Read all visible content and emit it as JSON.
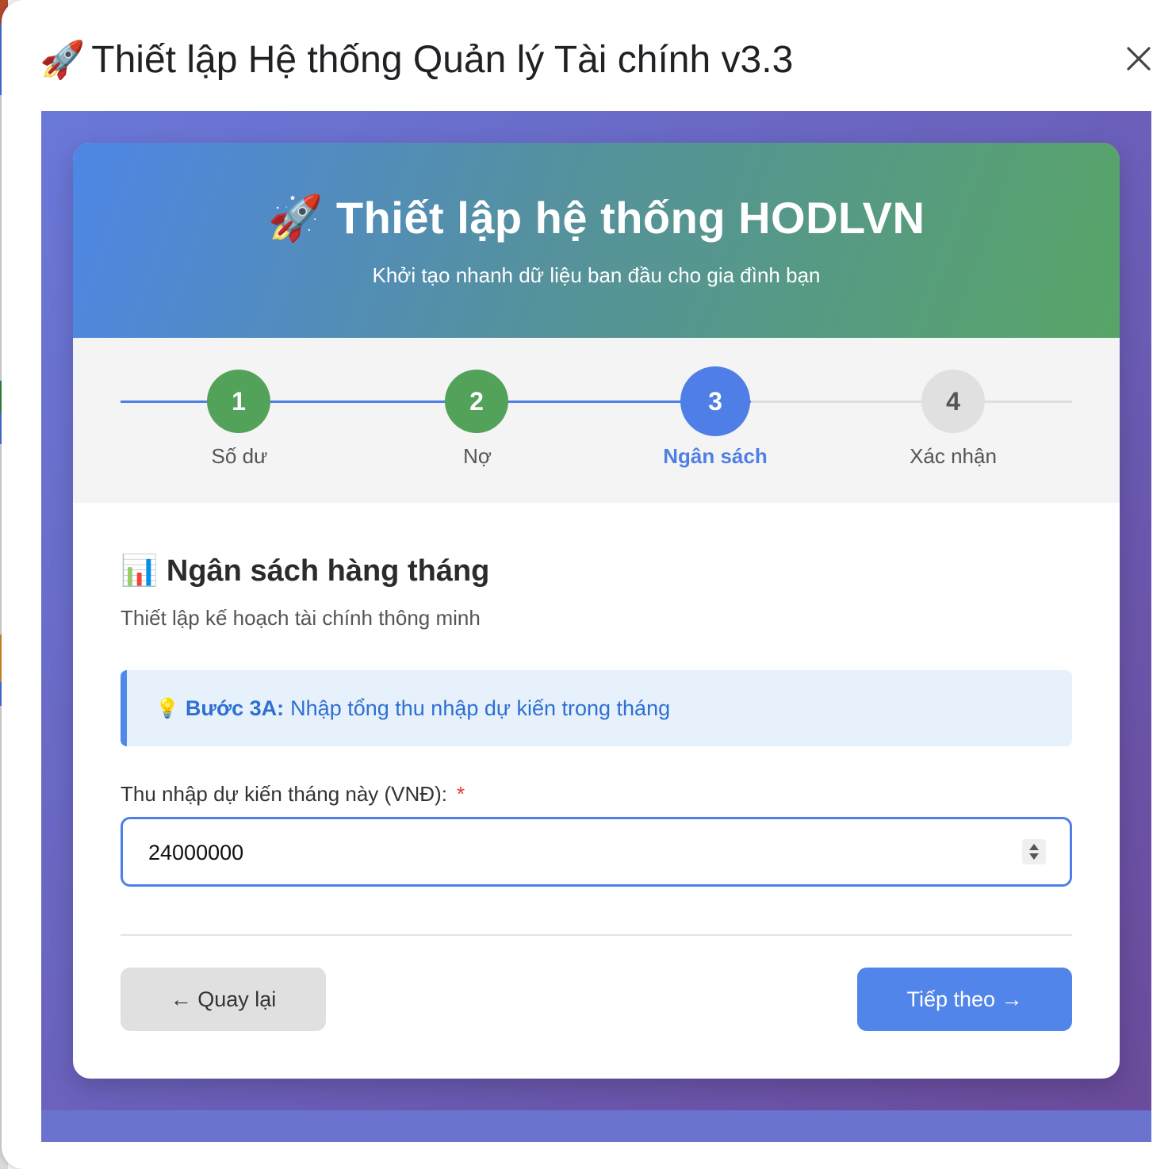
{
  "dialog": {
    "title_icon": "🚀",
    "title": "Thiết lập Hệ thống Quản lý Tài chính v3.3",
    "close_icon": "close-icon"
  },
  "hero": {
    "icon": "🚀",
    "title": "Thiết lập hệ thống HODLVN",
    "subtitle": "Khởi tạo nhanh dữ liệu ban đầu cho gia đình bạn"
  },
  "steps": [
    {
      "number": "1",
      "label": "Số dư",
      "state": "done"
    },
    {
      "number": "2",
      "label": "Nợ",
      "state": "done"
    },
    {
      "number": "3",
      "label": "Ngân sách",
      "state": "active"
    },
    {
      "number": "4",
      "label": "Xác nhận",
      "state": "todo"
    }
  ],
  "section": {
    "icon": "📊",
    "title": "Ngân sách hàng tháng",
    "subtitle": "Thiết lập kế hoạch tài chính thông minh"
  },
  "info": {
    "icon": "💡",
    "bold": "Bước 3A:",
    "text": "Nhập tổng thu nhập dự kiến trong tháng"
  },
  "income_field": {
    "label": "Thu nhập dự kiến tháng này (VNĐ):",
    "required": "*",
    "value": "24000000"
  },
  "buttons": {
    "back": "← Quay lại",
    "next": "Tiếp theo →"
  },
  "colors": {
    "accent": "#4f7fe6",
    "done": "#53a25a",
    "todo": "#e0e0e0",
    "frame_bg": "#6a5eb8"
  }
}
